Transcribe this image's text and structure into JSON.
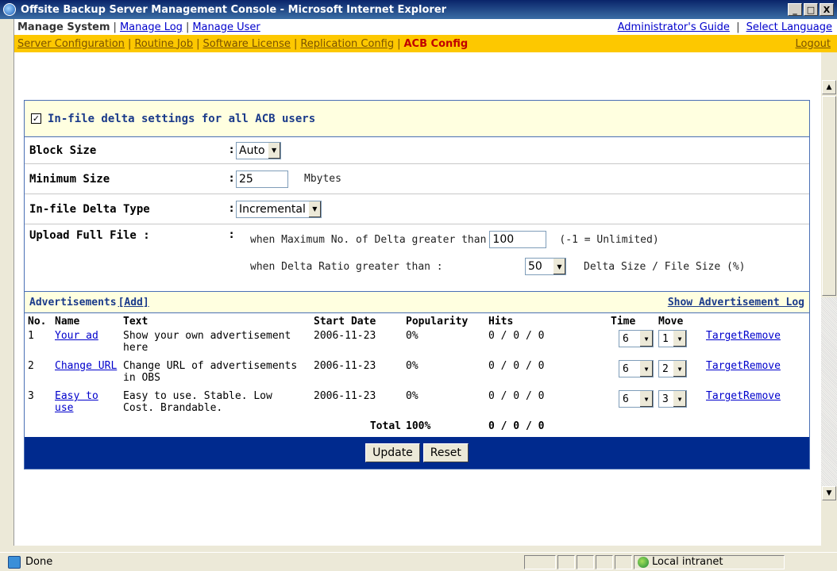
{
  "window": {
    "title": "Offsite Backup Server Management Console - Microsoft Internet Explorer",
    "buttons": [
      "_",
      "□",
      "X"
    ]
  },
  "nav1": {
    "current": "Manage System",
    "links": [
      "Manage Log",
      "Manage User"
    ],
    "right_links": [
      "Administrator's Guide",
      "Select Language"
    ]
  },
  "nav2": {
    "links": [
      "Server Configuration",
      "Routine Job",
      "Software License",
      "Replication Config"
    ],
    "active": "ACB Config",
    "logout": "Logout"
  },
  "delta": {
    "checkbox_label": "In-file delta settings for all ACB users",
    "checked": true,
    "block_size": {
      "label": "Block Size",
      "value": "Auto"
    },
    "minimum_size": {
      "label": "Minimum Size",
      "value": "25",
      "unit": "Mbytes"
    },
    "delta_type": {
      "label": "In-file Delta Type",
      "value": "Incremental"
    },
    "upload_full": {
      "label": "Upload Full File :",
      "max_delta_text": "when Maximum No. of Delta greater than",
      "max_delta_value": "100",
      "max_delta_note": "(-1 = Unlimited)",
      "ratio_text": "when Delta Ratio greater than :",
      "ratio_value": "50",
      "ratio_note": "Delta Size / File Size (%)"
    }
  },
  "ads": {
    "title": "Advertisements",
    "add_label": "[Add]",
    "log_link": "Show Advertisement Log",
    "columns": {
      "no": "No.",
      "name": "Name",
      "text": "Text",
      "start": "Start Date",
      "popularity": "Popularity",
      "hits": "Hits",
      "time": "Time",
      "move": "Move"
    },
    "rows": [
      {
        "no": "1",
        "name": "Your ad",
        "text": "Show your own advertisement here",
        "start": "2006-11-23",
        "popularity": "0%",
        "hits": "0 / 0 / 0",
        "time": "6",
        "move": "1"
      },
      {
        "no": "2",
        "name": "Change URL",
        "text": "Change URL of advertisements in OBS",
        "start": "2006-11-23",
        "popularity": "0%",
        "hits": "0 / 0 / 0",
        "time": "6",
        "move": "2"
      },
      {
        "no": "3",
        "name": "Easy to use",
        "text": "Easy to use. Stable. Low Cost. Brandable.",
        "start": "2006-11-23",
        "popularity": "0%",
        "hits": "0 / 0 / 0",
        "time": "6",
        "move": "3"
      }
    ],
    "row_actions": {
      "target": "Target",
      "remove": "Remove"
    },
    "total": {
      "label": "Total",
      "popularity": "100%",
      "hits": "0 / 0 / 0"
    }
  },
  "buttons": {
    "update": "Update",
    "reset": "Reset"
  },
  "status": {
    "text": "Done",
    "zone": "Local intranet"
  }
}
